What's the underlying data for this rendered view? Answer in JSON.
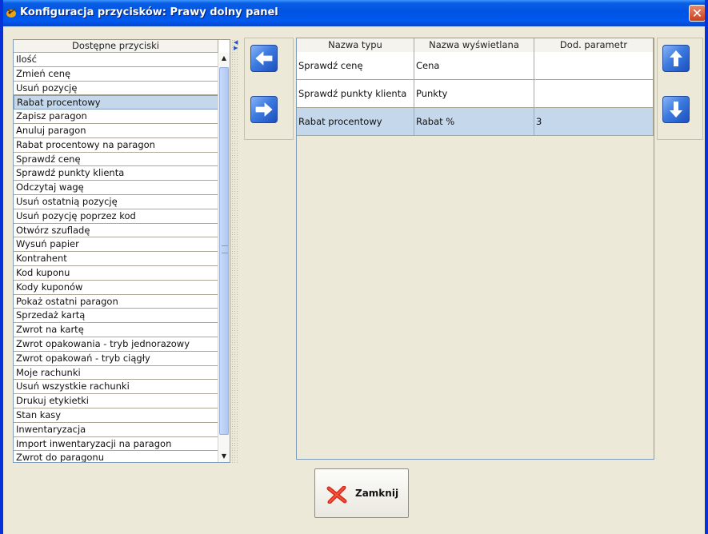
{
  "window": {
    "title": "Konfiguracja przycisków: Prawy dolny panel",
    "close_symbol": "✕"
  },
  "available_list": {
    "header": "Dostępne przyciski",
    "selected_index": 3,
    "items": [
      "Ilość",
      "Zmień cenę",
      "Usuń pozycję",
      "Rabat procentowy",
      "Zapisz paragon",
      "Anuluj paragon",
      "Rabat procentowy na paragon",
      "Sprawdź cenę",
      "Sprawdź punkty klienta",
      "Odczytaj wagę",
      "Usuń ostatnią pozycję",
      "Usuń pozycję poprzez kod",
      "Otwórz szufladę",
      "Wysuń papier",
      "Kontrahent",
      "Kod kuponu",
      "Kody kuponów",
      "Pokaż ostatni paragon",
      "Sprzedaż kartą",
      "Zwrot na kartę",
      "Zwrot opakowania - tryb jednorazowy",
      "Zwrot opakowań - tryb ciągły",
      "Moje rachunki",
      "Usuń wszystkie rachunki",
      "Drukuj etykietki",
      "Stan kasy",
      "Inwentaryzacja",
      "Import inwentaryzacji na paragon",
      "Zwrot do paragonu"
    ]
  },
  "assigned_table": {
    "columns": [
      "Nazwa typu",
      "Nazwa wyświetlana",
      "Dod. parametr"
    ],
    "selected_row": 2,
    "rows": [
      [
        "Sprawdź cenę",
        "Cena",
        ""
      ],
      [
        "Sprawdź punkty klienta",
        "Punkty",
        ""
      ],
      [
        "Rabat procentowy",
        " Rabat %",
        "3"
      ]
    ]
  },
  "icons": {
    "move_left": "arrow-left-icon",
    "move_right": "arrow-right-icon",
    "move_up": "arrow-up-icon",
    "move_down": "arrow-down-icon",
    "close": "red-x-icon"
  },
  "colors": {
    "titlebar": "#0054e3",
    "selection": "#c5d7ea",
    "button_blue": "#3d7be0",
    "close_red": "#e0301e"
  },
  "footer": {
    "close_label": "Zamknij"
  }
}
